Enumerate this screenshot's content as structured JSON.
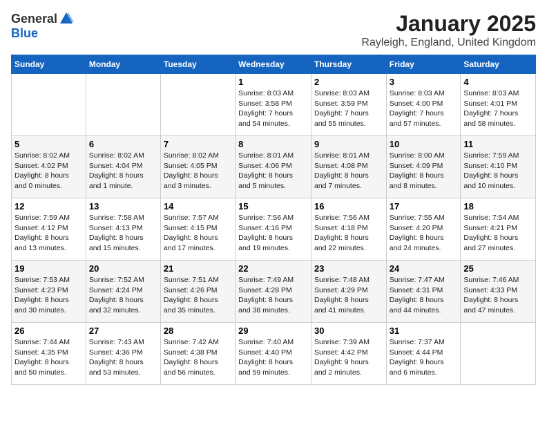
{
  "header": {
    "logo_general": "General",
    "logo_blue": "Blue",
    "title": "January 2025",
    "subtitle": "Rayleigh, England, United Kingdom"
  },
  "days_of_week": [
    "Sunday",
    "Monday",
    "Tuesday",
    "Wednesday",
    "Thursday",
    "Friday",
    "Saturday"
  ],
  "weeks": [
    [
      {
        "day": "",
        "info": ""
      },
      {
        "day": "",
        "info": ""
      },
      {
        "day": "",
        "info": ""
      },
      {
        "day": "1",
        "info": "Sunrise: 8:03 AM\nSunset: 3:58 PM\nDaylight: 7 hours\nand 54 minutes."
      },
      {
        "day": "2",
        "info": "Sunrise: 8:03 AM\nSunset: 3:59 PM\nDaylight: 7 hours\nand 55 minutes."
      },
      {
        "day": "3",
        "info": "Sunrise: 8:03 AM\nSunset: 4:00 PM\nDaylight: 7 hours\nand 57 minutes."
      },
      {
        "day": "4",
        "info": "Sunrise: 8:03 AM\nSunset: 4:01 PM\nDaylight: 7 hours\nand 58 minutes."
      }
    ],
    [
      {
        "day": "5",
        "info": "Sunrise: 8:02 AM\nSunset: 4:02 PM\nDaylight: 8 hours\nand 0 minutes."
      },
      {
        "day": "6",
        "info": "Sunrise: 8:02 AM\nSunset: 4:04 PM\nDaylight: 8 hours\nand 1 minute."
      },
      {
        "day": "7",
        "info": "Sunrise: 8:02 AM\nSunset: 4:05 PM\nDaylight: 8 hours\nand 3 minutes."
      },
      {
        "day": "8",
        "info": "Sunrise: 8:01 AM\nSunset: 4:06 PM\nDaylight: 8 hours\nand 5 minutes."
      },
      {
        "day": "9",
        "info": "Sunrise: 8:01 AM\nSunset: 4:08 PM\nDaylight: 8 hours\nand 7 minutes."
      },
      {
        "day": "10",
        "info": "Sunrise: 8:00 AM\nSunset: 4:09 PM\nDaylight: 8 hours\nand 8 minutes."
      },
      {
        "day": "11",
        "info": "Sunrise: 7:59 AM\nSunset: 4:10 PM\nDaylight: 8 hours\nand 10 minutes."
      }
    ],
    [
      {
        "day": "12",
        "info": "Sunrise: 7:59 AM\nSunset: 4:12 PM\nDaylight: 8 hours\nand 13 minutes."
      },
      {
        "day": "13",
        "info": "Sunrise: 7:58 AM\nSunset: 4:13 PM\nDaylight: 8 hours\nand 15 minutes."
      },
      {
        "day": "14",
        "info": "Sunrise: 7:57 AM\nSunset: 4:15 PM\nDaylight: 8 hours\nand 17 minutes."
      },
      {
        "day": "15",
        "info": "Sunrise: 7:56 AM\nSunset: 4:16 PM\nDaylight: 8 hours\nand 19 minutes."
      },
      {
        "day": "16",
        "info": "Sunrise: 7:56 AM\nSunset: 4:18 PM\nDaylight: 8 hours\nand 22 minutes."
      },
      {
        "day": "17",
        "info": "Sunrise: 7:55 AM\nSunset: 4:20 PM\nDaylight: 8 hours\nand 24 minutes."
      },
      {
        "day": "18",
        "info": "Sunrise: 7:54 AM\nSunset: 4:21 PM\nDaylight: 8 hours\nand 27 minutes."
      }
    ],
    [
      {
        "day": "19",
        "info": "Sunrise: 7:53 AM\nSunset: 4:23 PM\nDaylight: 8 hours\nand 30 minutes."
      },
      {
        "day": "20",
        "info": "Sunrise: 7:52 AM\nSunset: 4:24 PM\nDaylight: 8 hours\nand 32 minutes."
      },
      {
        "day": "21",
        "info": "Sunrise: 7:51 AM\nSunset: 4:26 PM\nDaylight: 8 hours\nand 35 minutes."
      },
      {
        "day": "22",
        "info": "Sunrise: 7:49 AM\nSunset: 4:28 PM\nDaylight: 8 hours\nand 38 minutes."
      },
      {
        "day": "23",
        "info": "Sunrise: 7:48 AM\nSunset: 4:29 PM\nDaylight: 8 hours\nand 41 minutes."
      },
      {
        "day": "24",
        "info": "Sunrise: 7:47 AM\nSunset: 4:31 PM\nDaylight: 8 hours\nand 44 minutes."
      },
      {
        "day": "25",
        "info": "Sunrise: 7:46 AM\nSunset: 4:33 PM\nDaylight: 8 hours\nand 47 minutes."
      }
    ],
    [
      {
        "day": "26",
        "info": "Sunrise: 7:44 AM\nSunset: 4:35 PM\nDaylight: 8 hours\nand 50 minutes."
      },
      {
        "day": "27",
        "info": "Sunrise: 7:43 AM\nSunset: 4:36 PM\nDaylight: 8 hours\nand 53 minutes."
      },
      {
        "day": "28",
        "info": "Sunrise: 7:42 AM\nSunset: 4:38 PM\nDaylight: 8 hours\nand 56 minutes."
      },
      {
        "day": "29",
        "info": "Sunrise: 7:40 AM\nSunset: 4:40 PM\nDaylight: 8 hours\nand 59 minutes."
      },
      {
        "day": "30",
        "info": "Sunrise: 7:39 AM\nSunset: 4:42 PM\nDaylight: 9 hours\nand 2 minutes."
      },
      {
        "day": "31",
        "info": "Sunrise: 7:37 AM\nSunset: 4:44 PM\nDaylight: 9 hours\nand 6 minutes."
      },
      {
        "day": "",
        "info": ""
      }
    ]
  ]
}
